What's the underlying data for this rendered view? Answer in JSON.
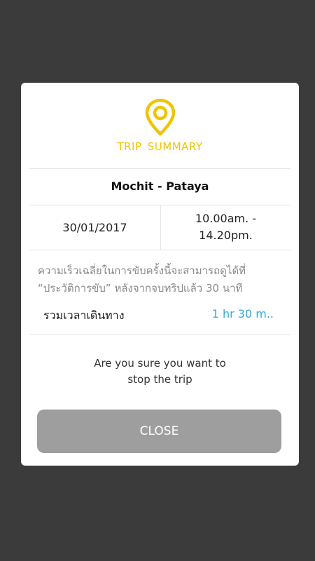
{
  "dialog": {
    "title": "TRIP  SUMMARY",
    "icon": "location-pin-icon",
    "accent_color": "#f0c400",
    "route": "Mochit - Pataya",
    "date": "30/01/2017",
    "time_line1": "10.00am. -",
    "time_line2": "14.20pm.",
    "note_line1": "ความเร็วเฉลี่ยในการขับครั้งนี้จะสามารถดูได้ที่",
    "note_line2": "“ประวัติการขับ” หลังจากจบทริปแล้ว 30 นาที",
    "total_label": "รวมเวลาเดินทาง",
    "total_value": "1 hr 30 m..",
    "total_value_color": "#3aa8d8",
    "confirm_line1": "Are you sure you want to",
    "confirm_line2": "stop the trip",
    "close_label": "CLOSE"
  }
}
